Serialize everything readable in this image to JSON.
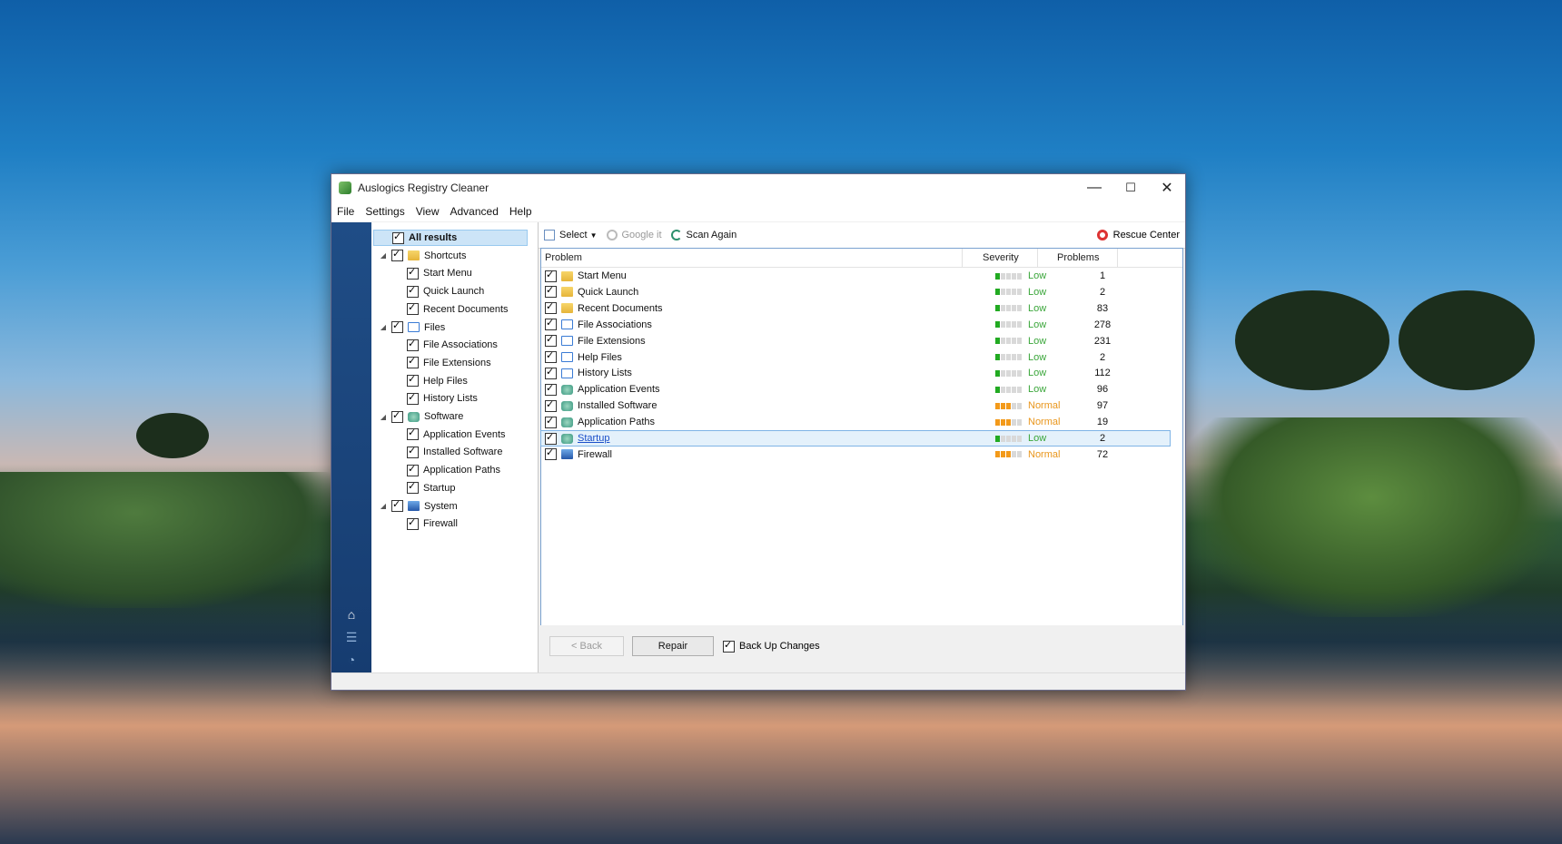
{
  "window": {
    "title": "Auslogics Registry Cleaner",
    "controls": {
      "minimize": "—",
      "maximize": "☐",
      "close": "✕"
    }
  },
  "menu": [
    "File",
    "Settings",
    "View",
    "Advanced",
    "Help"
  ],
  "nav": {
    "icons": [
      "home-icon",
      "list-icon",
      "gauge-icon"
    ]
  },
  "tree": {
    "all_results": "All results",
    "groups": [
      {
        "label": "Shortcuts",
        "icon": "folder-icon",
        "children": [
          "Start Menu",
          "Quick Launch",
          "Recent Documents"
        ]
      },
      {
        "label": "Files",
        "icon": "file-icon",
        "children": [
          "File Associations",
          "File Extensions",
          "Help Files",
          "History Lists"
        ]
      },
      {
        "label": "Software",
        "icon": "software-icon",
        "children": [
          "Application Events",
          "Installed Software",
          "Application Paths",
          "Startup"
        ]
      },
      {
        "label": "System",
        "icon": "system-icon",
        "children": [
          "Firewall"
        ]
      }
    ]
  },
  "toolbar": {
    "select": "Select",
    "google": "Google it",
    "scan_again": "Scan Again",
    "rescue_center": "Rescue Center"
  },
  "table": {
    "headers": {
      "problem": "Problem",
      "severity": "Severity",
      "problems": "Problems"
    },
    "rows": [
      {
        "name": "Start Menu",
        "icon": "folder-icon",
        "severity": "Low",
        "level": 1,
        "count": "1"
      },
      {
        "name": "Quick Launch",
        "icon": "folder-icon",
        "severity": "Low",
        "level": 1,
        "count": "2"
      },
      {
        "name": "Recent Documents",
        "icon": "folder-icon",
        "severity": "Low",
        "level": 1,
        "count": "83"
      },
      {
        "name": "File Associations",
        "icon": "file-icon",
        "severity": "Low",
        "level": 1,
        "count": "278"
      },
      {
        "name": "File Extensions",
        "icon": "file-icon",
        "severity": "Low",
        "level": 1,
        "count": "231"
      },
      {
        "name": "Help Files",
        "icon": "file-icon",
        "severity": "Low",
        "level": 1,
        "count": "2"
      },
      {
        "name": "History Lists",
        "icon": "file-icon",
        "severity": "Low",
        "level": 1,
        "count": "112"
      },
      {
        "name": "Application Events",
        "icon": "software-icon",
        "severity": "Low",
        "level": 1,
        "count": "96"
      },
      {
        "name": "Installed Software",
        "icon": "software-icon",
        "severity": "Normal",
        "level": 3,
        "count": "97"
      },
      {
        "name": "Application Paths",
        "icon": "software-icon",
        "severity": "Normal",
        "level": 3,
        "count": "19"
      },
      {
        "name": "Startup",
        "icon": "software-icon",
        "severity": "Low",
        "level": 1,
        "count": "2"
      },
      {
        "name": "Firewall",
        "icon": "system-icon",
        "severity": "Normal",
        "level": 3,
        "count": "72"
      }
    ]
  },
  "bottom": {
    "back": "< Back",
    "repair": "Repair",
    "backup": "Back Up Changes"
  }
}
